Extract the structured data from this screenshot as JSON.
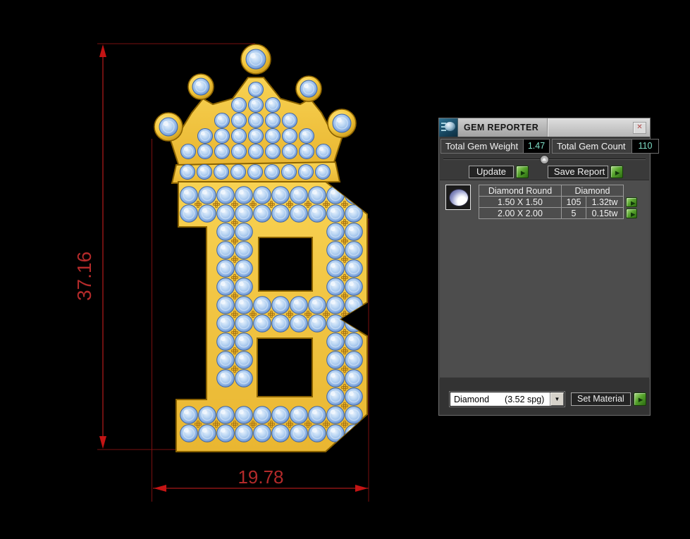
{
  "panel": {
    "title": "GEM REPORTER",
    "stats": {
      "weight_label": "Total Gem Weight",
      "weight_value": "1.47",
      "count_label": "Total Gem Count",
      "count_value": "110"
    },
    "buttons": {
      "update": "Update",
      "save_report": "Save Report",
      "set_material": "Set Material"
    },
    "table": {
      "header": [
        "Diamond Round",
        "Diamond"
      ],
      "rows": [
        {
          "size": "1.50 X 1.50",
          "count": "105",
          "weight": "1.32tw"
        },
        {
          "size": "2.00 X 2.00",
          "count": "5",
          "weight": "0.15tw"
        }
      ]
    },
    "material": {
      "name": "Diamond",
      "spg": "(3.52 spg)"
    }
  },
  "dimensions": {
    "height": "37.16",
    "width": "19.78"
  },
  "icons": {
    "play": "▶",
    "down": "▼",
    "close": "✕"
  },
  "colors": {
    "gold": "#F2C23C",
    "gold_dark": "#8A6200",
    "gold_deep": "#C9951A",
    "gem_blue": "#9CC1EC",
    "gem_edge": "#3F66A8",
    "bead_gold": "#DFA62B",
    "bead_edge": "#7A5200",
    "dim_line": "#A81818",
    "dim_ext": "#7A1010",
    "dim_arrow": "#C41414",
    "dim_text": "#B32A2A",
    "value_teal": "#7FE0C8",
    "button_green": "#58A52E"
  }
}
